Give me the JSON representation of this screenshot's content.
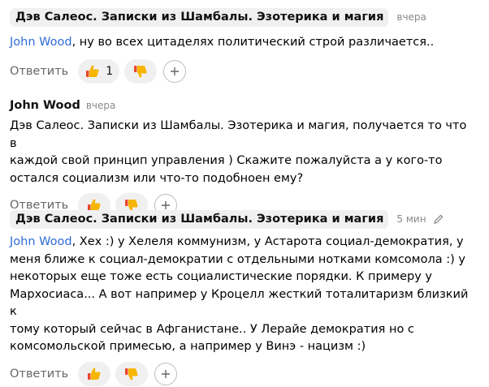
{
  "reply_label": "Ответить",
  "comments": [
    {
      "author": "Дэв Салеос. Записки из Шамбалы. Эзотерика и магия",
      "time": "вчера",
      "mention": "John Wood",
      "text": ", ну во всех цитаделях политический строй различается..",
      "likes": "1"
    },
    {
      "author": "John Wood",
      "time": "вчера",
      "text_lines": [
        "Дэв Салеос. Записки из Шамбалы. Эзотерика и магия, получается то что в",
        "каждой свой принцип управления ) Скажите пожалуйста а у кого-то",
        "остался социализм или что-то подобноен ему?"
      ]
    },
    {
      "author": "Дэв Салеос. Записки из Шамбалы. Эзотерика и магия",
      "time": "5 мин",
      "mention": "John Wood",
      "text_lines": [
        ", Хех :) у Хелеля коммунизм, у Астарота социал-демократия, у",
        "меня ближе к социал-демократии с отдельными нотками комсомола :) у",
        "некоторых еще тоже есть социалистические порядки. К примеру у",
        "Мархосиаса... А вот например у Кроцелл жесткий тоталитаризм близкий к",
        "тому который сейчас в Афганистане.. У Лерайе демократия но с",
        "комсомольской примесью, а например у Винэ - нацизм :)"
      ]
    }
  ],
  "icons": {
    "like": "thumbs-up-icon",
    "dislike": "thumbs-down-icon",
    "add": "plus-icon",
    "edit": "pencil-icon"
  },
  "colors": {
    "mention": "#2f6bd6",
    "pill_bg": "#f0f0f0",
    "thumb_yellow": "#f7b500",
    "thumb_red": "#e8472c"
  }
}
